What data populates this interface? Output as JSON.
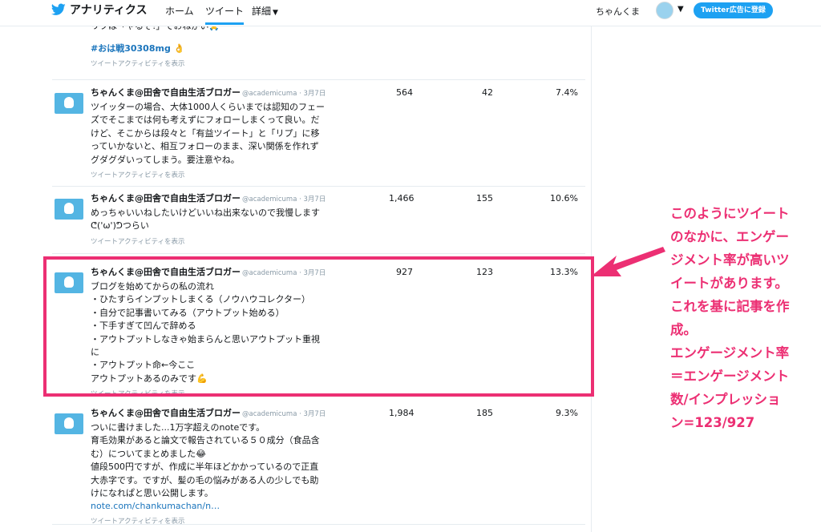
{
  "nav": {
    "brand": "アナリティクス",
    "home": "ホーム",
    "tweets": "ツイート",
    "details": "詳細",
    "username": "ちゃんくま",
    "ad_button": "Twitter広告に登録"
  },
  "top_partial": {
    "text": "リフは「やるぞ!」でおねがい🙏",
    "hashtag": "#おは戦30308mg 👌",
    "activity": "ツイートアクティビティを表示"
  },
  "tweets": [
    {
      "name": "ちゃんくま@田舎で自由生活ブロガー",
      "handle": "@academicuma · 3月7日",
      "text": "ツイッターの場合、大体1000人くらいまでは認知のフェー\nズでそこまでは何も考えずにフォローしまくって良い。だ\nけど、そこからは段々と「有益ツイート」と「リプ」に移\nっていかないと、相互フォローのまま、深い関係を作れず\nグダグダいってしまう。要注意やね。",
      "link": "",
      "activity": "ツイートアクティビティを表示",
      "impressions": "564",
      "engagements": "42",
      "rate": "7.4%"
    },
    {
      "name": "ちゃんくま@田舎で自由生活ブロガー",
      "handle": "@academicuma · 3月7日",
      "text": "めっちゃいいねしたいけどいいね出来ないので我慢します\nᕦ('ω')ᕤつらい",
      "link": "",
      "activity": "ツイートアクティビティを表示",
      "impressions": "1,466",
      "engagements": "155",
      "rate": "10.6%"
    },
    {
      "name": "ちゃんくま@田舎で自由生活ブロガー",
      "handle": "@academicuma · 3月7日",
      "text": "ブログを始めてからの私の流れ\n・ひたすらインプットしまくる（ノウハウコレクター）\n・自分で記事書いてみる（アウトプット始める）\n・下手すぎて凹んで辞める\n・アウトプットしなきゃ始まらんと思いアウトプット重視\nに\n・アウトプット命←今ここ\nアウトプットあるのみです💪",
      "link": "",
      "activity": "ツイートアクティビティを表示",
      "impressions": "927",
      "engagements": "123",
      "rate": "13.3%"
    },
    {
      "name": "ちゃんくま@田舎で自由生活ブロガー",
      "handle": "@academicuma · 3月7日",
      "text": "ついに書けました...1万字超えのnoteです。\n育毛効果があると論文で報告されている５０成分（食品含\nむ）についてまとめました😂\n値段500円ですが、作成に半年ほどかかっているので正直\n大赤字です。ですが、髪の毛の悩みがある人の少しでも助\nけになれぱと思い公開します。",
      "link": "note.com/chankumachan/n…",
      "activity": "ツイートアクティビティを表示",
      "impressions": "1,984",
      "engagements": "185",
      "rate": "9.3%"
    }
  ],
  "annotation": "このようにツイート\nのなかに、エンゲー\nジメント率が高いツ\nイートがあります。\nこれを基に記事を作\n成。\nエンゲージメント率\n＝エンゲージメント\n数/インプレッショ\nン=123/927",
  "colors": {
    "accent": "#1da1f2",
    "highlight": "#ec2f73",
    "link": "#1b75bc"
  }
}
